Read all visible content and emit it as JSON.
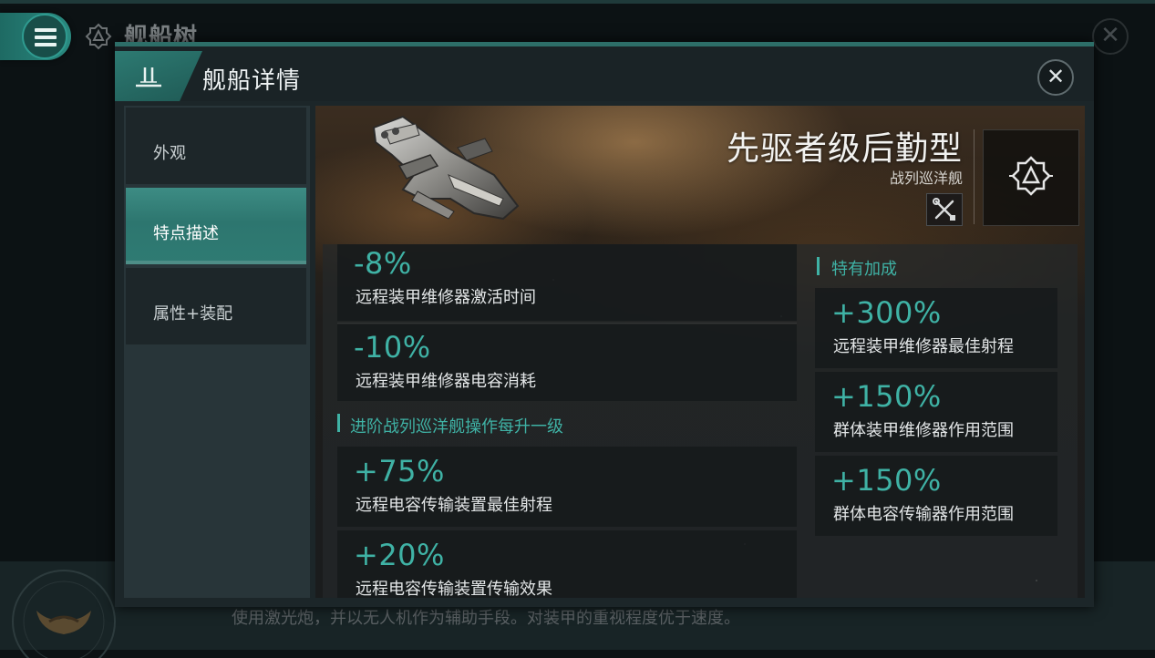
{
  "background": {
    "title": "舰船树",
    "description": "使用激光炮，并以无人机作为辅助手段。对装甲的重视程度优于速度。"
  },
  "modal": {
    "title": "舰船详情"
  },
  "nav": {
    "items": [
      {
        "label": "外观"
      },
      {
        "label": "特点描述"
      },
      {
        "label": "属性+装配"
      }
    ],
    "active_index": 1
  },
  "ship": {
    "name": "先驱者级后勤型",
    "class": "战列巡洋舰"
  },
  "left_bonuses": [
    {
      "value": "-8%",
      "description": "远程装甲维修器激活时间"
    },
    {
      "value": "-10%",
      "description": "远程装甲维修器电容消耗"
    }
  ],
  "advanced_section": {
    "heading": "进阶战列巡洋舰操作每升一级",
    "bonuses": [
      {
        "value": "+75%",
        "description": "远程电容传输装置最佳射程"
      },
      {
        "value": "+20%",
        "description": "远程电容传输装置传输效果"
      }
    ]
  },
  "special_section": {
    "heading": "特有加成",
    "bonuses": [
      {
        "value": "+300%",
        "description": "远程装甲维修器最佳射程"
      },
      {
        "value": "+150%",
        "description": "群体装甲维修器作用范围"
      },
      {
        "value": "+150%",
        "description": "群体电容传输器作用范围"
      }
    ]
  },
  "colors": {
    "accent": "#3fb2a5",
    "nav_active": "#2f7b73"
  }
}
